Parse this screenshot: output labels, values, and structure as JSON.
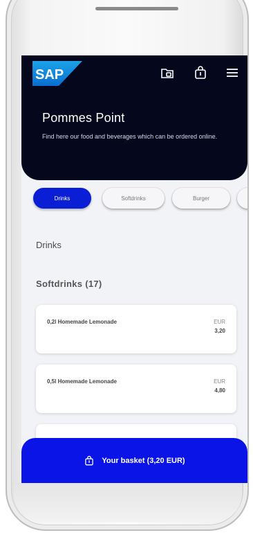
{
  "header": {
    "logo_text": "SAP",
    "shop_title": "Pommes Point",
    "shop_description": "Find here our food and beverages which can be ordered online.",
    "icons": [
      "orders-icon",
      "basket-icon",
      "menu-icon"
    ]
  },
  "categories": [
    {
      "label": "Drinks",
      "active": true
    },
    {
      "label": "Softdrinks",
      "active": false
    },
    {
      "label": "Burger",
      "active": false
    }
  ],
  "section_title": "Drinks",
  "group": {
    "title": "Softdrinks (17)"
  },
  "products": [
    {
      "name": "0,2l Homemade Lemonade",
      "currency": "EUR",
      "price": "3,20"
    },
    {
      "name": "0,5l Homemade Lemonade",
      "currency": "EUR",
      "price": "4,80"
    }
  ],
  "basket": {
    "label": "Your basket (3,20 EUR)"
  },
  "colors": {
    "header_bg": "#05071d",
    "accent": "#0a1ed6",
    "basket_bar": "#0a14e6",
    "screen_bg": "#f2f3f7"
  }
}
